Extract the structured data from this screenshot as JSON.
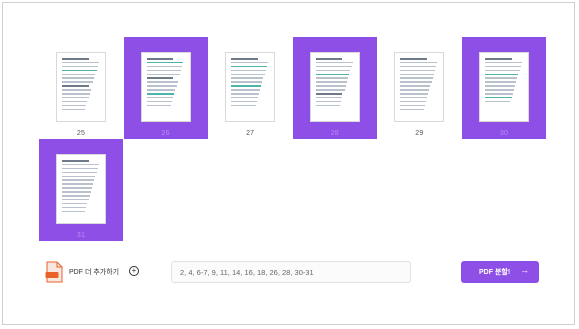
{
  "pages": [
    {
      "number": "25",
      "selected": false
    },
    {
      "number": "26",
      "selected": true
    },
    {
      "number": "27",
      "selected": false
    },
    {
      "number": "28",
      "selected": true
    },
    {
      "number": "29",
      "selected": false
    },
    {
      "number": "30",
      "selected": true
    },
    {
      "number": "31",
      "selected": true
    }
  ],
  "footer": {
    "add_pdf_label": "PDF 더 추가하기",
    "range_value": "2, 4, 6-7, 9, 11, 14, 16, 18, 26, 28, 30-31",
    "split_label": "PDF 분할!"
  },
  "colors": {
    "accent": "#8e4fe6",
    "pdf_icon": "#e8622a"
  },
  "icons": {
    "pdf": "pdf-file-icon",
    "add": "plus-circle-icon",
    "split_arrow": "arrow-right-icon"
  }
}
